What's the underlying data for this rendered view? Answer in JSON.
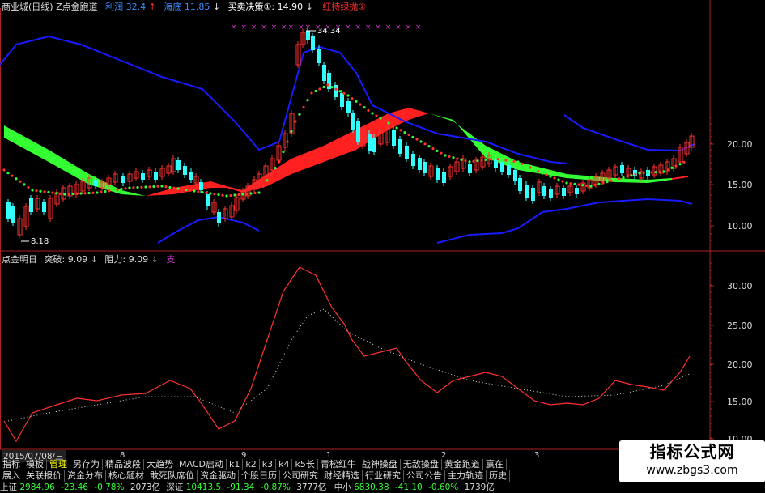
{
  "header": {
    "title": "商业城(日线) Z点金跑道",
    "profit_label": "利润",
    "profit_value": "32.4",
    "profit_arrow": "↑",
    "sea_label": "海底",
    "sea_value": "11.85",
    "sea_arrow": "↓",
    "decision": "买卖决策①: 14.90",
    "decision_arrow": "↓",
    "redgreen": "红持绿抛②"
  },
  "price_labels": {
    "high": "34.34",
    "low": "8.18"
  },
  "price_axis": [
    "20.00",
    "15.00",
    "10.00"
  ],
  "indicator": {
    "name": "点金明日",
    "break_label": "突破: 9.09",
    "break_arrow": "↓",
    "resist_label": "阻力: 9.09",
    "resist_arrow": "↓",
    "support": "支"
  },
  "indicator_axis": [
    "30.00",
    "25.00",
    "20.00",
    "15.00",
    "10.00"
  ],
  "time_axis": {
    "date": "2015/07/08/三",
    "marks": [
      "8",
      "9",
      "1",
      "2",
      "3"
    ]
  },
  "tabs_row1": [
    "指标",
    "模板",
    "管理",
    "另存为",
    "精品波段",
    "大趋势",
    "MACD启动",
    "k1",
    "k2",
    "k3",
    "k4",
    "k5长",
    "青松红牛",
    "战神操盘",
    "无敌操盘",
    "黄金跑道",
    "赢在"
  ],
  "tabs_row2": [
    "展入",
    "关联报价",
    "资金分布",
    "核心题材",
    "敢死队席位",
    "资金驱动",
    "个股日历",
    "公司研究",
    "财经精选",
    "行业研究",
    "公司公告",
    "主力轨迹",
    "历史"
  ],
  "status": {
    "sh_label": "上证",
    "sh_value": "2984.96",
    "sh_change": "-23.46",
    "sh_pct": "-0.78%",
    "sh_amount": "2073亿",
    "sz_label": "深证",
    "sz_value": "10413.5",
    "sz_change": "-91.34",
    "sz_pct": "-0.87%",
    "sz_amount": "3777亿",
    "zx_label": "中小",
    "zx_value": "6830.38",
    "zx_change": "-41.10",
    "zx_pct": "-0.60%",
    "zx_amount": "1739亿"
  },
  "watermark": {
    "line1": "指标公式网",
    "line2": "www.zbgs3.com"
  },
  "colors": {
    "up": "#ff3030",
    "down": "#33ffff",
    "green_band": "#33ff33",
    "red_band": "#ff2020",
    "boll": "#1a1aff",
    "axis": "#aa2222"
  }
}
